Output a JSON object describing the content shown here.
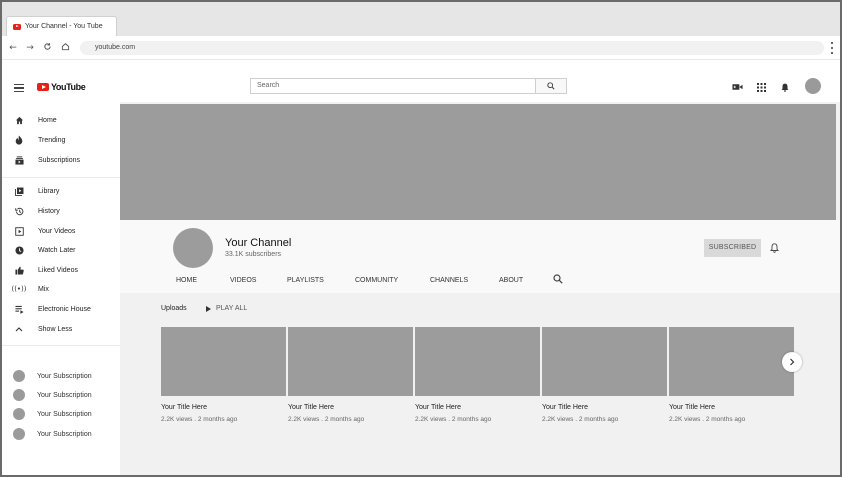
{
  "browser": {
    "tab_title": "Your Channel - You Tube",
    "url": "youtube.com",
    "nav_icons": [
      "back-arrow-icon",
      "forward-arrow-icon",
      "reload-icon",
      "home-icon"
    ]
  },
  "header": {
    "logo_text": "YouTube",
    "search_placeholder": "Search",
    "right_icons": [
      "video-camera-icon",
      "apps-grid-icon",
      "bell-icon",
      "account-avatar"
    ]
  },
  "sidebar": {
    "group1": [
      {
        "label": "Home",
        "icon": "home-icon"
      },
      {
        "label": "Trending",
        "icon": "flame-icon"
      },
      {
        "label": "Subscriptions",
        "icon": "subscriptions-icon"
      }
    ],
    "group2": [
      {
        "label": "Library",
        "icon": "library-icon"
      },
      {
        "label": "History",
        "icon": "history-icon"
      },
      {
        "label": "Your Videos",
        "icon": "play-square-icon"
      },
      {
        "label": "Watch Later",
        "icon": "clock-icon"
      },
      {
        "label": "Liked Videos",
        "icon": "thumb-up-icon"
      },
      {
        "label": "Mix",
        "icon": "broadcast-icon"
      },
      {
        "label": "Electronic House",
        "icon": "playlist-icon"
      },
      {
        "label": "Show Less",
        "icon": "chevron-up-icon"
      }
    ],
    "subscriptions": [
      {
        "label": "Your Subscription"
      },
      {
        "label": "Your Subscription"
      },
      {
        "label": "Your Subscription"
      },
      {
        "label": "Your Subscription"
      }
    ]
  },
  "channel": {
    "name": "Your Channel",
    "subscribers": "33.1K subscribers",
    "subscribe_label": "SUBSCRIBED",
    "tabs": [
      "HOME",
      "VIDEOS",
      "PLAYLISTS",
      "COMMUNITY",
      "CHANNELS",
      "ABOUT"
    ]
  },
  "uploads": {
    "label": "Uploads",
    "play_all": "PLAY ALL",
    "videos": [
      {
        "title": "Your Title Here",
        "meta": "2.2K views . 2 months ago"
      },
      {
        "title": "Your Title Here",
        "meta": "2.2K views . 2 months ago"
      },
      {
        "title": "Your Title Here",
        "meta": "2.2K views . 2 months ago"
      },
      {
        "title": "Your Title Here",
        "meta": "2.2K views . 2 months ago"
      },
      {
        "title": "Your Title Here",
        "meta": "2.2K views . 2 months ago"
      }
    ]
  },
  "colors": {
    "brand_red": "#e62117",
    "placeholder_gray": "#9c9c9c",
    "page_background": "#f1f1f1"
  }
}
